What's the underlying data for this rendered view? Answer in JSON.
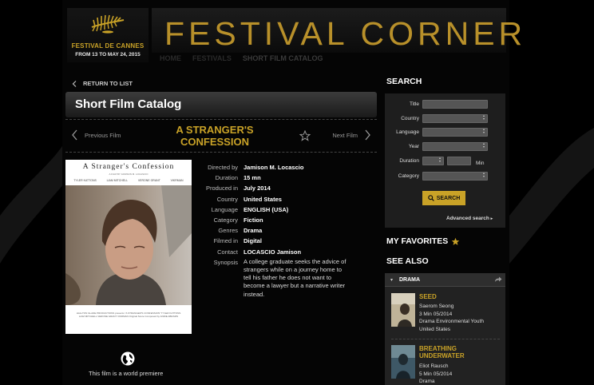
{
  "festival": {
    "name": "FESTIVAL DE CANNES",
    "dates": "FROM 13 TO MAY 24, 2015",
    "banner_title": "FESTIVAL CORNER"
  },
  "topnav": [
    "HOME",
    "FESTIVALS",
    "SHORT FILM CATALOG"
  ],
  "back_label": "RETURN TO LIST",
  "catalog_title": "Short Film Catalog",
  "film_nav": {
    "prev": "Previous Film",
    "next": "Next Film",
    "title_line1": "A STRANGER'S",
    "title_line2": "CONFESSION"
  },
  "poster": {
    "title": "A Stranger's Confession",
    "subtitle": "A FILM BY JAMISON M. LOCASCIO",
    "cast": [
      "TYLER KATTONS",
      "LIAM MITCHELL",
      "VERONE GRANT",
      "VIKRMAN"
    ],
    "credits": "HALLTON GLADE PRODUCTIONS presents \"A STRANGER'S CONFESSION\" TYLER KATTONS LIAM MITCHELL VERONE GRANT VIKRMAN Original Score Composed by ANDIE ABRAMS"
  },
  "details": [
    {
      "label": "Directed by",
      "value": "Jamison M. Locascio"
    },
    {
      "label": "Duration",
      "value": "15 mn"
    },
    {
      "label": "Produced in",
      "value": "July 2014"
    },
    {
      "label": "Country",
      "value": "United States"
    },
    {
      "label": "Language",
      "value": "ENGLISH (USA)"
    },
    {
      "label": "Category",
      "value": "Fiction"
    },
    {
      "label": "Genres",
      "value": "Drama"
    },
    {
      "label": "Filmed in",
      "value": "Digital"
    },
    {
      "label": "Contact",
      "value": "LOCASCIO Jamison"
    }
  ],
  "synopsis": {
    "label": "Synopsis",
    "text": "A college graduate seeks the advice of strangers while on a journey home to tell his father he does not want to become a lawyer but a narrative writer instead."
  },
  "premiere": "This film is a world premiere",
  "search": {
    "heading": "SEARCH",
    "title_label": "Title",
    "country_label": "Country",
    "language_label": "Language",
    "year_label": "Year",
    "duration_label": "Duration",
    "duration_unit": "Min",
    "category_label": "Category",
    "button": "SEARCH",
    "advanced": "Advanced search"
  },
  "favorites_heading": "MY FAVORITES",
  "see_also": {
    "heading": "SEE ALSO",
    "genre": "DRAMA",
    "films": [
      {
        "title": "SEED",
        "author": "Saerom Seong",
        "meta": "3 Min 05/2014",
        "tags": "Drama Environmental Youth",
        "country": "United States"
      },
      {
        "title": "BREATHING UNDERWATER",
        "author": "Eliot Rausch",
        "meta": "5 Min 05/2014",
        "tags": "Drama"
      }
    ]
  },
  "colors": {
    "gold": "#c9a227",
    "background": "#000000",
    "panel": "#1e1e1e"
  }
}
